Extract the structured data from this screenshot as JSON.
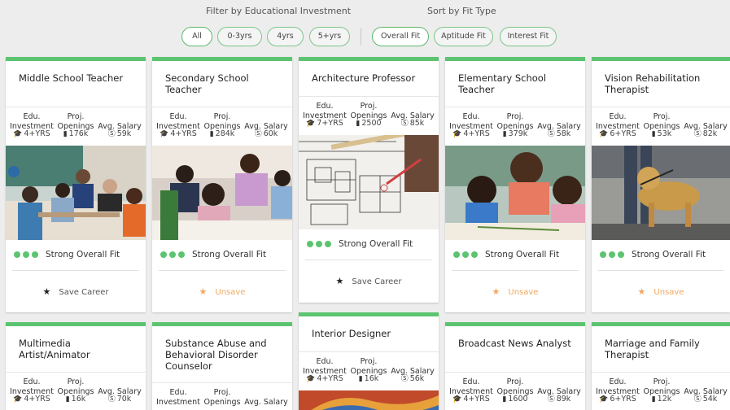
{
  "filters": {
    "education_title": "Filter by Educational Investment",
    "sort_title": "Sort by Fit Type",
    "education_options": [
      "All",
      "0-3yrs",
      "4yrs",
      "5+yrs"
    ],
    "sort_options": [
      "Overall Fit",
      "Aptitude Fit",
      "Interest Fit"
    ],
    "active_education": "All",
    "active_sort": "Overall Fit"
  },
  "labels": {
    "edu_line1": "Edu.",
    "edu_line2": "Investment",
    "proj_line1": "Proj.",
    "proj_line2": "Openings",
    "salary_label": "Avg. Salary",
    "fit_label": "Strong Overall Fit",
    "save_label": "Save Career",
    "unsave_label": "Unsave"
  },
  "colors": {
    "accent_green": "#5cc470",
    "saved_orange": "#f0a860"
  },
  "cards": [
    {
      "title": "Middle School Teacher",
      "edu": "4+YRS",
      "openings": "176k",
      "salary": "59k",
      "saved": false,
      "image": "classroom"
    },
    {
      "title": "Secondary School Teacher",
      "edu": "4+YRS",
      "openings": "284k",
      "salary": "60k",
      "saved": true,
      "image": "students-writing"
    },
    {
      "title": "Architecture Professor",
      "edu": "7+YRS",
      "openings": "2500",
      "salary": "85k",
      "saved": false,
      "image": "blueprint-sketch"
    },
    {
      "title": "Elementary School Teacher",
      "edu": "4+YRS",
      "openings": "379k",
      "salary": "58k",
      "saved": true,
      "image": "teacher-with-kids"
    },
    {
      "title": "Vision Rehabilitation Therapist",
      "edu": "6+YRS",
      "openings": "53k",
      "salary": "82k",
      "saved": true,
      "image": "guide-dog"
    },
    {
      "title": "Multimedia Artist/Animator",
      "edu": "4+YRS",
      "openings": "16k",
      "salary": "70k",
      "saved": false,
      "image": ""
    },
    {
      "title": "Substance Abuse and Behavioral Disorder Counselor",
      "edu": "",
      "openings": "",
      "salary": "",
      "saved": false,
      "image": ""
    },
    {
      "title": "Interior Designer",
      "edu": "4+YRS",
      "openings": "16k",
      "salary": "56k",
      "saved": false,
      "image": "fabric-swatches"
    },
    {
      "title": "Broadcast News Analyst",
      "edu": "4+YRS",
      "openings": "1600",
      "salary": "89k",
      "saved": false,
      "image": ""
    },
    {
      "title": "Marriage and Family Therapist",
      "edu": "6+YRS",
      "openings": "12k",
      "salary": "54k",
      "saved": false,
      "image": ""
    }
  ]
}
